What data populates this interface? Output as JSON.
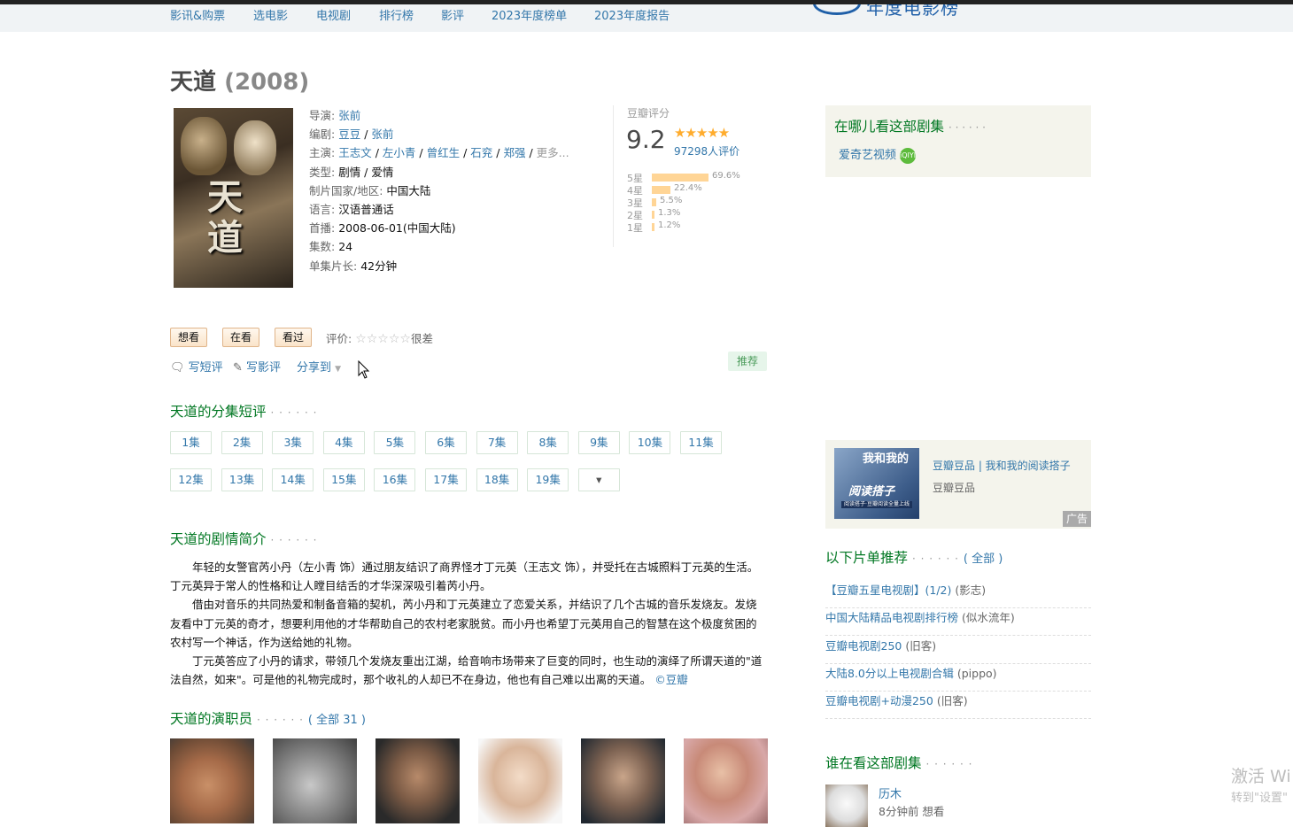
{
  "nav": {
    "items": [
      "影讯&购票",
      "选电影",
      "电视剧",
      "排行榜",
      "影评",
      "2023年度榜单",
      "2023年度报告"
    ],
    "logo_text": "年度电影榜单"
  },
  "title": {
    "name": "天道",
    "year": "(2008)"
  },
  "poster": {
    "title_text": "天道"
  },
  "info": {
    "director_label": "导演:",
    "director": "张前",
    "writer_label": "编剧:",
    "writers": [
      "豆豆",
      "张前"
    ],
    "cast_label": "主演:",
    "cast": [
      "王志文",
      "左小青",
      "曾红生",
      "石兖",
      "郑强"
    ],
    "cast_more": "更多...",
    "genre_label": "类型:",
    "genre": "剧情 / 爱情",
    "country_label": "制片国家/地区:",
    "country": "中国大陆",
    "lang_label": "语言:",
    "lang": "汉语普通话",
    "premiere_label": "首播:",
    "premiere": "2008-06-01(中国大陆)",
    "episodes_label": "集数:",
    "episodes": "24",
    "runtime_label": "单集片长:",
    "runtime": "42分钟"
  },
  "rating": {
    "label": "豆瓣评分",
    "score": "9.2",
    "stars": "★★★★★",
    "votes": "97298人评价",
    "breakdown": [
      {
        "label": "5星",
        "pct": "69.6%",
        "value": 69.6
      },
      {
        "label": "4星",
        "pct": "22.4%",
        "value": 22.4
      },
      {
        "label": "3星",
        "pct": "5.5%",
        "value": 5.5
      },
      {
        "label": "2星",
        "pct": "1.3%",
        "value": 1.3
      },
      {
        "label": "1星",
        "pct": "1.2%",
        "value": 1.2
      }
    ]
  },
  "actions": {
    "want": "想看",
    "watching": "在看",
    "watched": "看过",
    "rate_label": "评价:",
    "rate_stars": "☆☆☆☆☆",
    "rate_hint": "很差",
    "short_review": "写短评",
    "review": "写影评",
    "share": "分享到",
    "recommend": "推荐"
  },
  "episodes_section": {
    "title": "天道的分集短评",
    "dots": "· · · · · ·",
    "row1": [
      "1集",
      "2集",
      "3集",
      "4集",
      "5集",
      "6集",
      "7集",
      "8集",
      "9集",
      "10集",
      "11集"
    ],
    "row2": [
      "12集",
      "13集",
      "14集",
      "15集",
      "16集",
      "17集",
      "18集",
      "19集"
    ]
  },
  "synopsis": {
    "title": "天道的剧情简介",
    "dots": "· · · · · ·",
    "p1": "年轻的女警官芮小丹（左小青 饰）通过朋友结识了商界怪才丁元英（王志文 饰），并受托在古城照料丁元英的生活。丁元英异于常人的性格和让人瞠目结舌的才华深深吸引着芮小丹。",
    "p2": "借由对音乐的共同热爱和制备音箱的契机，芮小丹和丁元英建立了恋爱关系，并结识了几个古城的音乐发烧友。发烧友看中丁元英的奇才，想要利用他的才华帮助自己的农村老家脱贫。而小丹也希望丁元英用自己的智慧在这个极度贫困的农村写一个神话，作为送给她的礼物。",
    "p3": "丁元英答应了小丹的请求，带领几个发烧友重出江湖，给音响市场带来了巨变的同时，也生动的演绎了所谓天道的\"道法自然，如来\"。可是他的礼物完成时，那个收礼的人却已不在身边，他也有自己难以出离的天道。",
    "credit": "©豆瓣"
  },
  "cast_section": {
    "title": "天道的演职员",
    "dots": "· · · · · ·",
    "all": "( 全部 31 )"
  },
  "where": {
    "title": "在哪儿看这部剧集",
    "dots": "· · · · · ·",
    "platform": "爱奇艺视频",
    "platform_icon": "iQIYI"
  },
  "ad": {
    "img_title": "我和我的",
    "img_sub": "阅读搭子",
    "img_banner": "阅读搭子·豆瓣阅读全量上线",
    "title": "豆瓣豆品 | 我和我的阅读搭子",
    "sub": "豆瓣豆品",
    "tag": "广告"
  },
  "lists": {
    "title": "以下片单推荐",
    "dots": "· · · · · ·",
    "all": "( 全部 )",
    "items": [
      {
        "name": "【豆瓣五星电视剧】(1/2)",
        "by": "(影志)"
      },
      {
        "name": "中国大陆精品电视剧排行榜",
        "by": "(似水流年)"
      },
      {
        "name": "豆瓣电视剧250",
        "by": "(旧客)"
      },
      {
        "name": "大陆8.0分以上电视剧合辑",
        "by": "(pippo)"
      },
      {
        "name": "豆瓣电视剧+动漫250",
        "by": "(旧客)"
      }
    ]
  },
  "viewers": {
    "title": "谁在看这部剧集",
    "dots": "· · · · · ·",
    "name": "历木",
    "activity": "8分钟前 想看"
  },
  "watermark": {
    "line1": "激活 Wi",
    "line2": "转到\"设置\""
  },
  "colors": {
    "link": "#3377aa",
    "green": "#007722",
    "star": "#ffac2d",
    "bar": "#ffd596"
  }
}
